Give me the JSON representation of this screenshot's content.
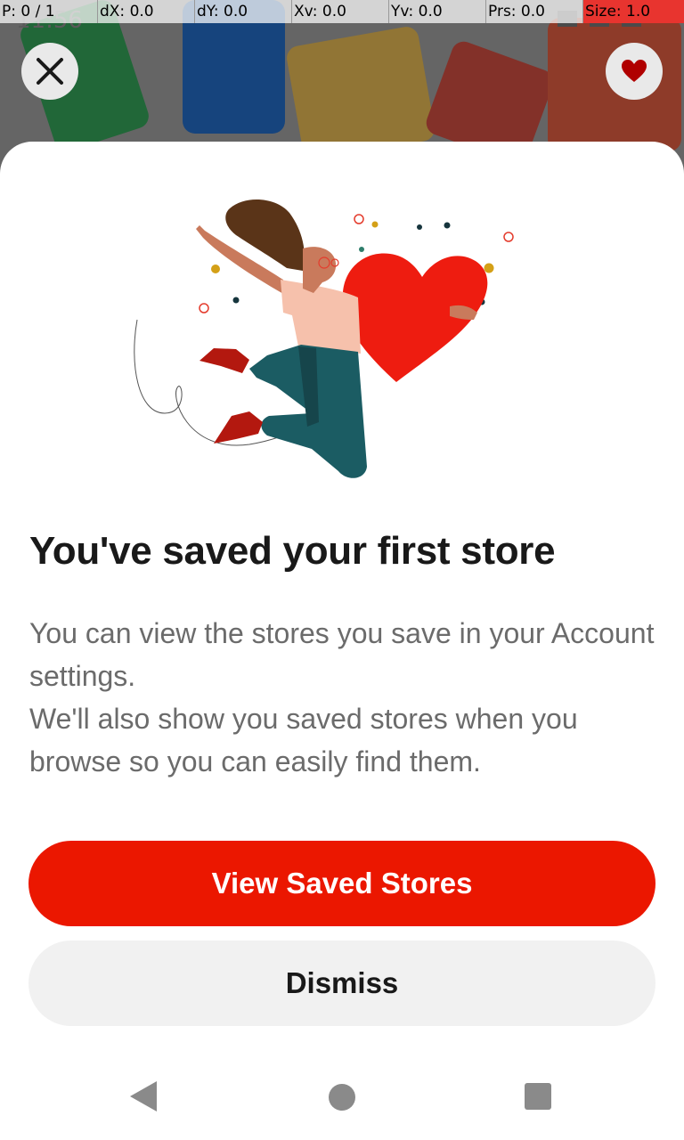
{
  "debug_bar": {
    "p": "P: 0 / 1",
    "dx": "dX: 0.0",
    "dy": "dY: 0.0",
    "xv": "Xv: 0.0",
    "yv": "Yv: 0.0",
    "prs": "Prs: 0.0",
    "size": "Size: 1.0"
  },
  "status_bar": {
    "time": "11:56"
  },
  "header": {
    "close_icon": "close-icon",
    "favorite_icon": "heart-icon"
  },
  "sheet": {
    "title": "You've saved your first store",
    "body_line_1": "You can view the stores you save in your Account settings.",
    "body_line_2": "We'll also show you saved stores when you browse so you can easily find them.",
    "primary_button": "View Saved Stores",
    "secondary_button": "Dismiss"
  },
  "nav": {
    "back_icon": "back-triangle-icon",
    "home_icon": "home-circle-icon",
    "recents_icon": "recents-square-icon"
  },
  "colors": {
    "accent": "#eb1700",
    "title": "#191919",
    "body": "#6b6b6b",
    "secondary_button": "#f1f1f1"
  }
}
